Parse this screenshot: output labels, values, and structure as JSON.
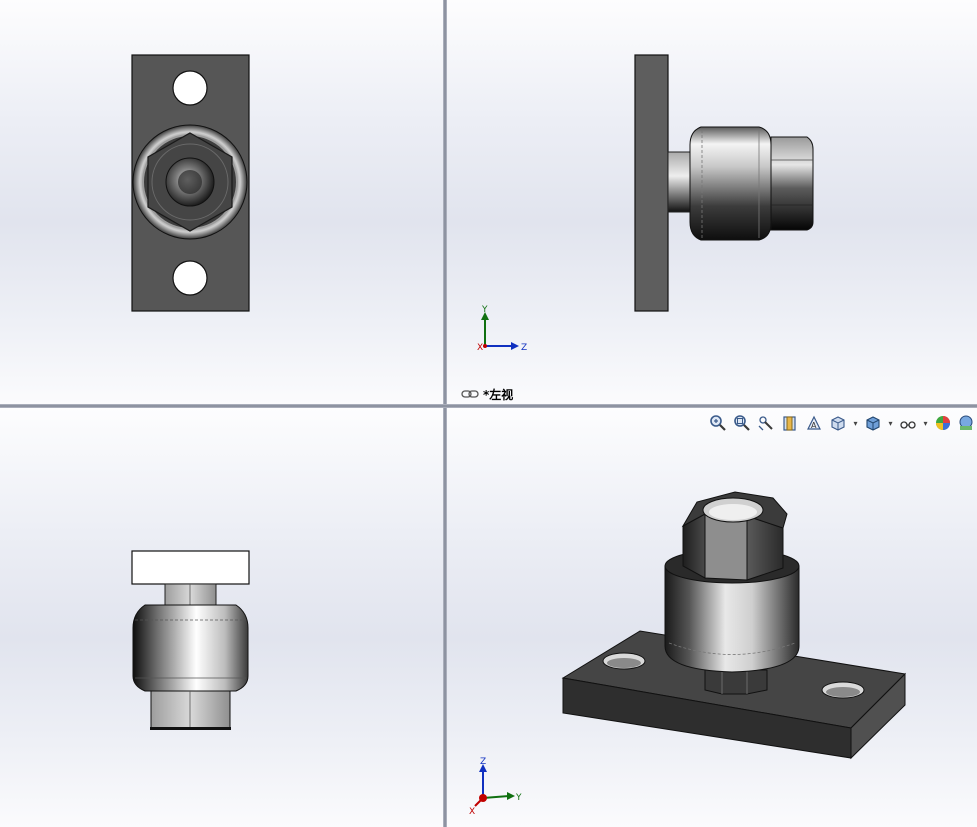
{
  "views": {
    "front": {
      "name": "front-view"
    },
    "left": {
      "name": "left-view",
      "label": "*左视"
    },
    "top": {
      "name": "top-view"
    },
    "iso": {
      "name": "isometric-view"
    }
  },
  "triad_left": {
    "axis_up": "Y",
    "axis_right": "Z",
    "axis_origin": "X"
  },
  "triad_iso": {
    "axis_up": "Z",
    "axis_right": "Y",
    "axis_origin": "X"
  },
  "toolbar": {
    "items": [
      "zoom-to-fit-icon",
      "zoom-to-area-icon",
      "previous-view-icon",
      "section-view-icon",
      "dynamic-annotation-icon",
      "view-orientation-icon",
      "display-style-icon",
      "hide-show-items-icon",
      "edit-appearance-icon",
      "apply-scene-icon"
    ]
  },
  "colors": {
    "plate": "#575757",
    "plate_edge": "#1a1a1a",
    "axis_x": "#c00000",
    "axis_y": "#107010",
    "axis_z": "#1030c0"
  }
}
